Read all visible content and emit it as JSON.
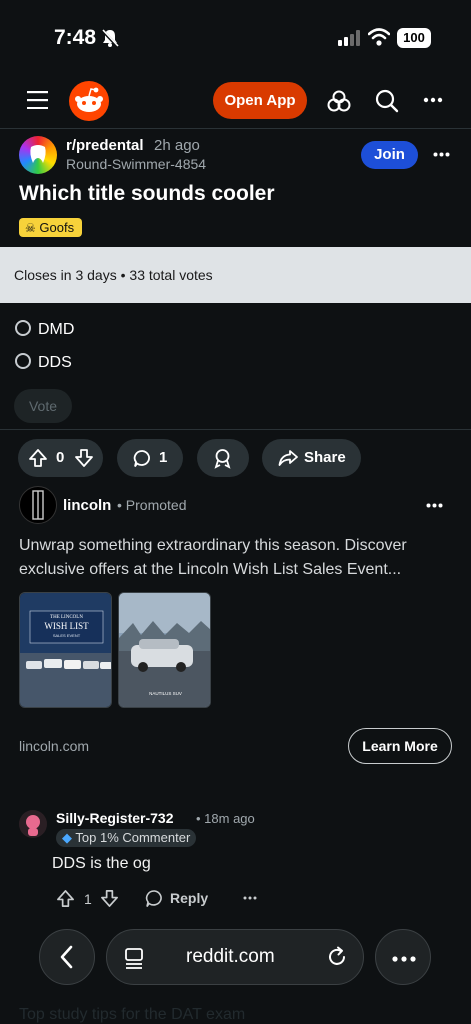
{
  "status_bar": {
    "time": "7:48",
    "battery": "100"
  },
  "header": {
    "open_app": "Open App"
  },
  "post": {
    "subreddit": "r/predental",
    "time_ago": "2h ago",
    "author": "Round-Swimmer-4854",
    "join_label": "Join",
    "title": "Which title sounds cooler",
    "flair": "Goofs",
    "poll": {
      "closes": "Closes in 3 days",
      "votes": "33 total votes",
      "options": [
        "DMD",
        "DDS"
      ],
      "vote_label": "Vote"
    },
    "actions": {
      "score": "0",
      "comments": "1",
      "share": "Share"
    }
  },
  "ad": {
    "advertiser": "lincoln",
    "promoted": "Promoted",
    "text": "Unwrap something extraordinary this season. Discover exclusive offers at the Lincoln Wish List Sales Event...",
    "image1_caption": "THE LINCOLN",
    "image1_title": "WISH LIST",
    "image1_sub": "SALES EVENT",
    "image2_caption": "NAUTILUS SUV",
    "domain": "lincoln.com",
    "cta": "Learn More"
  },
  "comment": {
    "author": "Silly-Register-732",
    "time_ago": "18m ago",
    "badge": "Top 1% Commenter",
    "text": "DDS is the og",
    "score": "1",
    "reply_label": "Reply"
  },
  "ghost_next": {
    "text": "Top study tips for the DAT exam"
  },
  "browser": {
    "url": "reddit.com"
  }
}
